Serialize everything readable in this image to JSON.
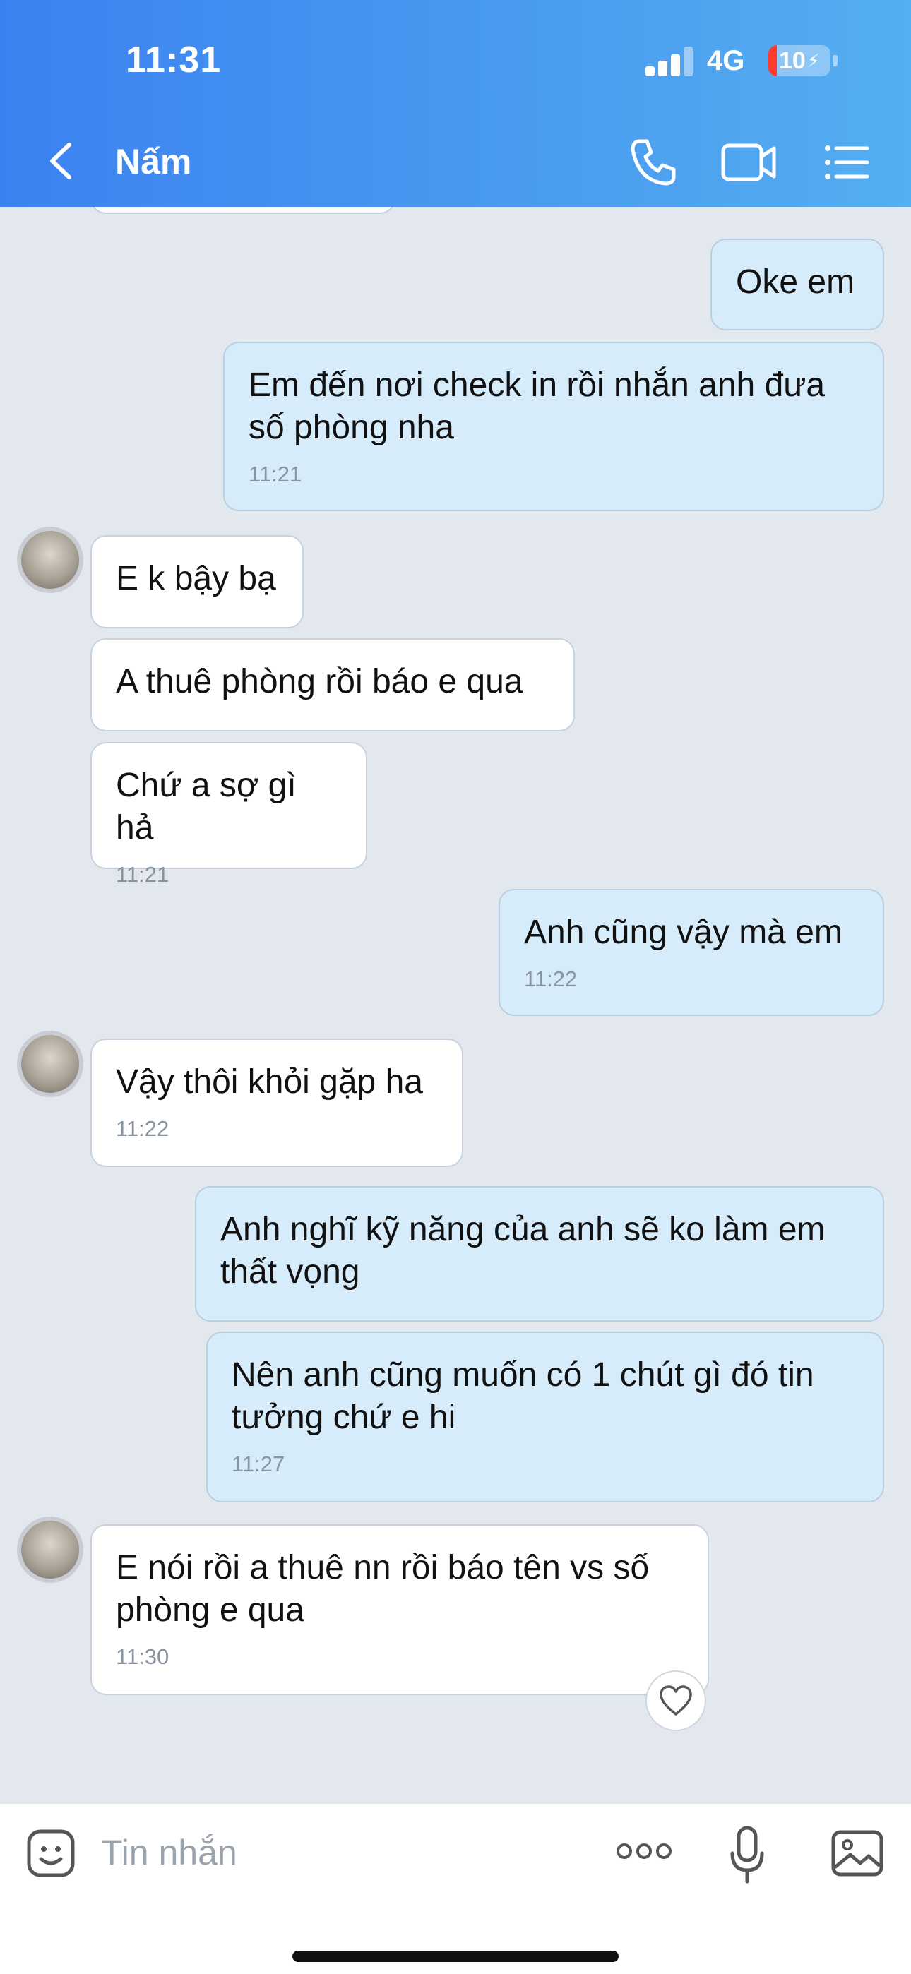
{
  "status_bar": {
    "time": "11:31",
    "network": "4G",
    "battery": "10"
  },
  "header": {
    "title": "Nấm"
  },
  "messages": [
    {
      "text": "Oke em",
      "time": ""
    },
    {
      "text": "Em đến nơi check in rồi nhắn anh đưa số phòng nha",
      "time": "11:21"
    },
    {
      "text": "E k bậy bạ",
      "time": ""
    },
    {
      "text": "A thuê phòng rồi báo e qua",
      "time": ""
    },
    {
      "text": "Chứ a sợ gì hả",
      "time": "11:21"
    },
    {
      "text": "Anh cũng vậy mà em",
      "time": "11:22"
    },
    {
      "text": "Vậy thôi khỏi gặp ha",
      "time": "11:22"
    },
    {
      "text": "Anh nghĩ kỹ năng của anh sẽ ko làm em thất vọng",
      "time": ""
    },
    {
      "text": "Nên anh cũng muốn có 1 chút gì đó tin tưởng chứ e hi",
      "time": "11:27"
    },
    {
      "text": "E nói rồi a thuê nn rồi báo tên vs số phòng e qua",
      "time": "11:30"
    }
  ],
  "composer": {
    "placeholder": "Tin nhắn"
  },
  "icons": {
    "back": "chevron-left-icon",
    "call": "phone-icon",
    "video": "video-camera-icon",
    "menu": "list-menu-icon",
    "sticker": "sticker-face-icon",
    "more": "more-dots-icon",
    "mic": "microphone-icon",
    "image": "image-icon",
    "reaction": "heart-icon"
  },
  "colors": {
    "header": "#3b82f0",
    "outgoing_bubble": "#d6ecfb",
    "incoming_bubble": "#ffffff",
    "chat_bg": "#e3e8ef"
  }
}
